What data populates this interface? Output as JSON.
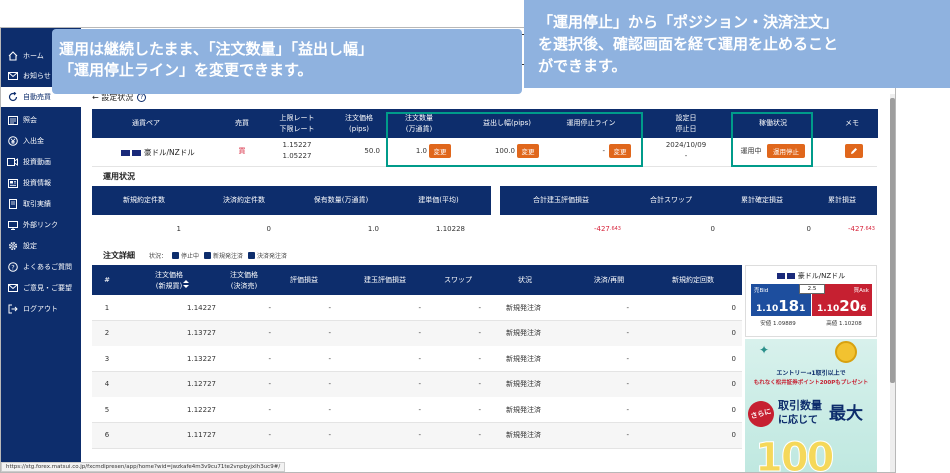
{
  "sidebar": {
    "items": [
      {
        "label": "ホーム",
        "icon": "home-icon"
      },
      {
        "label": "お知らせ",
        "icon": "mail-icon"
      },
      {
        "label": "自動売買",
        "icon": "refresh-icon"
      },
      {
        "label": "",
        "icon": "blank-icon"
      },
      {
        "label": "照会",
        "icon": "list-icon"
      },
      {
        "label": "入出金",
        "icon": "yen-icon"
      },
      {
        "label": "投資動画",
        "icon": "video-icon"
      },
      {
        "label": "投資情報",
        "icon": "news-icon"
      },
      {
        "label": "取引実績",
        "icon": "book-icon"
      },
      {
        "label": "外部リンク",
        "icon": "monitor-icon"
      },
      {
        "label": "設定",
        "icon": "gear-icon"
      },
      {
        "label": "よくあるご質問",
        "icon": "question-icon"
      },
      {
        "label": "ご意見・ご要望",
        "icon": "envelope-icon"
      },
      {
        "label": "ログアウト",
        "icon": "logout-icon"
      }
    ]
  },
  "callouts": {
    "left": {
      "line1": "運用は継続したまま、「注文数量」「益出し幅」",
      "line2": "「運用停止ライン」を変更できます。"
    },
    "right": {
      "line1": "「運用停止」から「ポジション・決済注文」",
      "line2": "を選択後、確認画面を経て運用を止めること",
      "line3": "ができます。"
    }
  },
  "page": {
    "back_label": "← 設定状況",
    "help_icon": "question-circle-icon"
  },
  "settings_table": {
    "headers": {
      "pair": "通貨ペア",
      "side": "売買",
      "upper_lower": [
        "上限レート",
        "下限レート"
      ],
      "width": [
        "注文価格",
        "(pips)"
      ],
      "qty": [
        "注文数量",
        "(万通貨)"
      ],
      "profit": "益出し幅(pips)",
      "stopline": "運用停止ライン",
      "dates": [
        "設定日",
        "停止日"
      ],
      "status": "稼働状況",
      "memo": "メモ"
    },
    "row": {
      "pair": "豪ドル/NZドル",
      "side": "買",
      "upper": "1.15227",
      "lower": "1.05227",
      "width": "50.0",
      "qty": "1.0",
      "profit": "100.0",
      "stopline": "-",
      "set_date": "2024/10/09",
      "stop_date": "-",
      "status": "運用中",
      "change_label": "変更",
      "stop_button": "運用停止"
    }
  },
  "status_section": {
    "title": "運用状況",
    "left_headers": [
      "新規約定件数",
      "決済約定件数",
      "保有数量(万通貨)",
      "建単価(平均)"
    ],
    "left_values": [
      "1",
      "0",
      "1.0",
      "1.10228"
    ],
    "right_headers": [
      "合計建玉評価損益",
      "合計スワップ",
      "累計確定損益",
      "累計損益"
    ],
    "right_values": [
      "-427",
      "0",
      "0",
      "-427"
    ],
    "right_decimals": [
      ".643",
      "",
      "",
      ".643"
    ]
  },
  "order_detail": {
    "title": "注文詳細",
    "filter_label": "状況：",
    "filters": [
      "停止中",
      "新規発注済",
      "決済発注済"
    ],
    "headers": {
      "num": "#",
      "price_new": [
        "注文価格",
        "(新規買)"
      ],
      "price_close": [
        "注文価格",
        "(決済売)"
      ],
      "eval": "評価損益",
      "pos_eval": "建玉評価損益",
      "swap": "スワップ",
      "status": "状況",
      "close_re": "決済/再開",
      "new_count": "新規約定回数"
    },
    "rows": [
      {
        "num": "1",
        "price": "1.14227",
        "close": "-",
        "eval": "-",
        "pos": "-",
        "swap": "-",
        "status": "新規発注済",
        "re": "-",
        "count": "0"
      },
      {
        "num": "2",
        "price": "1.13727",
        "close": "-",
        "eval": "-",
        "pos": "-",
        "swap": "-",
        "status": "新規発注済",
        "re": "-",
        "count": "0"
      },
      {
        "num": "3",
        "price": "1.13227",
        "close": "-",
        "eval": "-",
        "pos": "-",
        "swap": "-",
        "status": "新規発注済",
        "re": "-",
        "count": "0"
      },
      {
        "num": "4",
        "price": "1.12727",
        "close": "-",
        "eval": "-",
        "pos": "-",
        "swap": "-",
        "status": "新規発注済",
        "re": "-",
        "count": "0"
      },
      {
        "num": "5",
        "price": "1.12227",
        "close": "-",
        "eval": "-",
        "pos": "-",
        "swap": "-",
        "status": "新規発注済",
        "re": "-",
        "count": "0"
      },
      {
        "num": "6",
        "price": "1.11727",
        "close": "-",
        "eval": "-",
        "pos": "-",
        "swap": "-",
        "status": "新規発注済",
        "re": "-",
        "count": "0"
      }
    ]
  },
  "rate_panel": {
    "pair": "豪ドル/NZドル",
    "bid_label": "売Bid",
    "ask_label": "買Ask",
    "spread": "2.5",
    "bid_main": "1.10",
    "bid_big": "18",
    "bid_small": "1",
    "ask_main": "1.10",
    "ask_big": "20",
    "ask_small": "6",
    "low_label": "安値",
    "low_value": "1.09889",
    "high_label": "高値",
    "high_value": "1.10208"
  },
  "banner": {
    "line1": "エントリー→1取引以上で",
    "line2": "もれなく松井証券ポイント200Pもプレゼント",
    "sarani": "さらに",
    "big1": "取引数量",
    "big2": "に応じて",
    "big3": "最大",
    "number": "100"
  },
  "statusbar": {
    "url": "https://stg.forex.matsui.co.jp/fxcmdipresen/app/home?wid=jwzkafe4m3v9cu71te2vnpbyjxlh3uc9#/"
  },
  "colors": {
    "navy": "#0d2d6c",
    "orange": "#e0671c",
    "teal": "#009b8a",
    "callout": "#8fb2df",
    "red": "#d7263d"
  }
}
